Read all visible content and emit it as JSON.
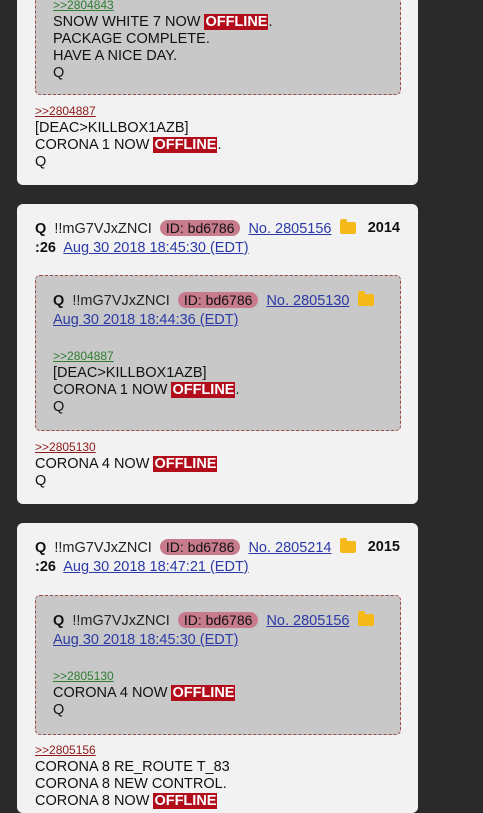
{
  "post0": {
    "quote_tail": {
      "ref": ">>2804843",
      "l1_text": "SNOW WHITE 7 NOW ",
      "l1_badge": "OFFLINE",
      "l1_after": ".",
      "l2": "PACKAGE COMPLETE.",
      "l3": "HAVE A NICE DAY.",
      "l4": "Q"
    },
    "ref": ">>2804887",
    "l1": "[DEAC>KILLBOX1AZB]",
    "l2_text": "CORONA 1 NOW ",
    "l2_badge": "OFFLINE",
    "l2_after": ".",
    "l3": "Q"
  },
  "post1": {
    "author": "Q",
    "trip": "!!mG7VJxZNCI",
    "id": "ID: bd6786",
    "no": "No. 2805156",
    "count_a": "2014",
    "count_b": ":26",
    "date": "Aug 30 2018 18:45:30 (EDT)",
    "quote": {
      "author": "Q",
      "trip": "!!mG7VJxZNCI",
      "id": "ID: bd6786",
      "no": "No. 2805130",
      "date": "Aug 30 2018 18:44:36 (EDT)",
      "ref": ">>2804887",
      "l1": "[DEAC>KILLBOX1AZB]",
      "l2_text": "CORONA 1 NOW ",
      "l2_badge": "OFFLINE",
      "l2_after": ".",
      "l3": "Q"
    },
    "ref": ">>2805130",
    "l1_text": "CORONA 4 NOW ",
    "l1_badge": "OFFLINE",
    "l2": "Q"
  },
  "post2": {
    "author": "Q",
    "trip": "!!mG7VJxZNCI",
    "id": "ID: bd6786",
    "no": "No. 2805214",
    "count_a": "2015",
    "count_b": ":26",
    "date": "Aug 30 2018 18:47:21 (EDT)",
    "quote": {
      "author": "Q",
      "trip": "!!mG7VJxZNCI",
      "id": "ID: bd6786",
      "no": "No. 2805156",
      "date": "Aug 30 2018 18:45:30 (EDT)",
      "ref": ">>2805130",
      "l1_text": "CORONA 4 NOW ",
      "l1_badge": "OFFLINE",
      "l2": "Q"
    },
    "ref": ">>2805156",
    "l1": "CORONA 8 RE_ROUTE T_83",
    "l2": "CORONA 8 NEW CONTROL.",
    "l3_text": "CORONA 8 NOW ",
    "l3_badge": "OFFLINE"
  },
  "icons": {
    "folder": "folder-icon"
  },
  "colors": {
    "offline_bg": "#b10d1a",
    "id_pill": "#c77b8d",
    "link": "#2b3aa6"
  }
}
